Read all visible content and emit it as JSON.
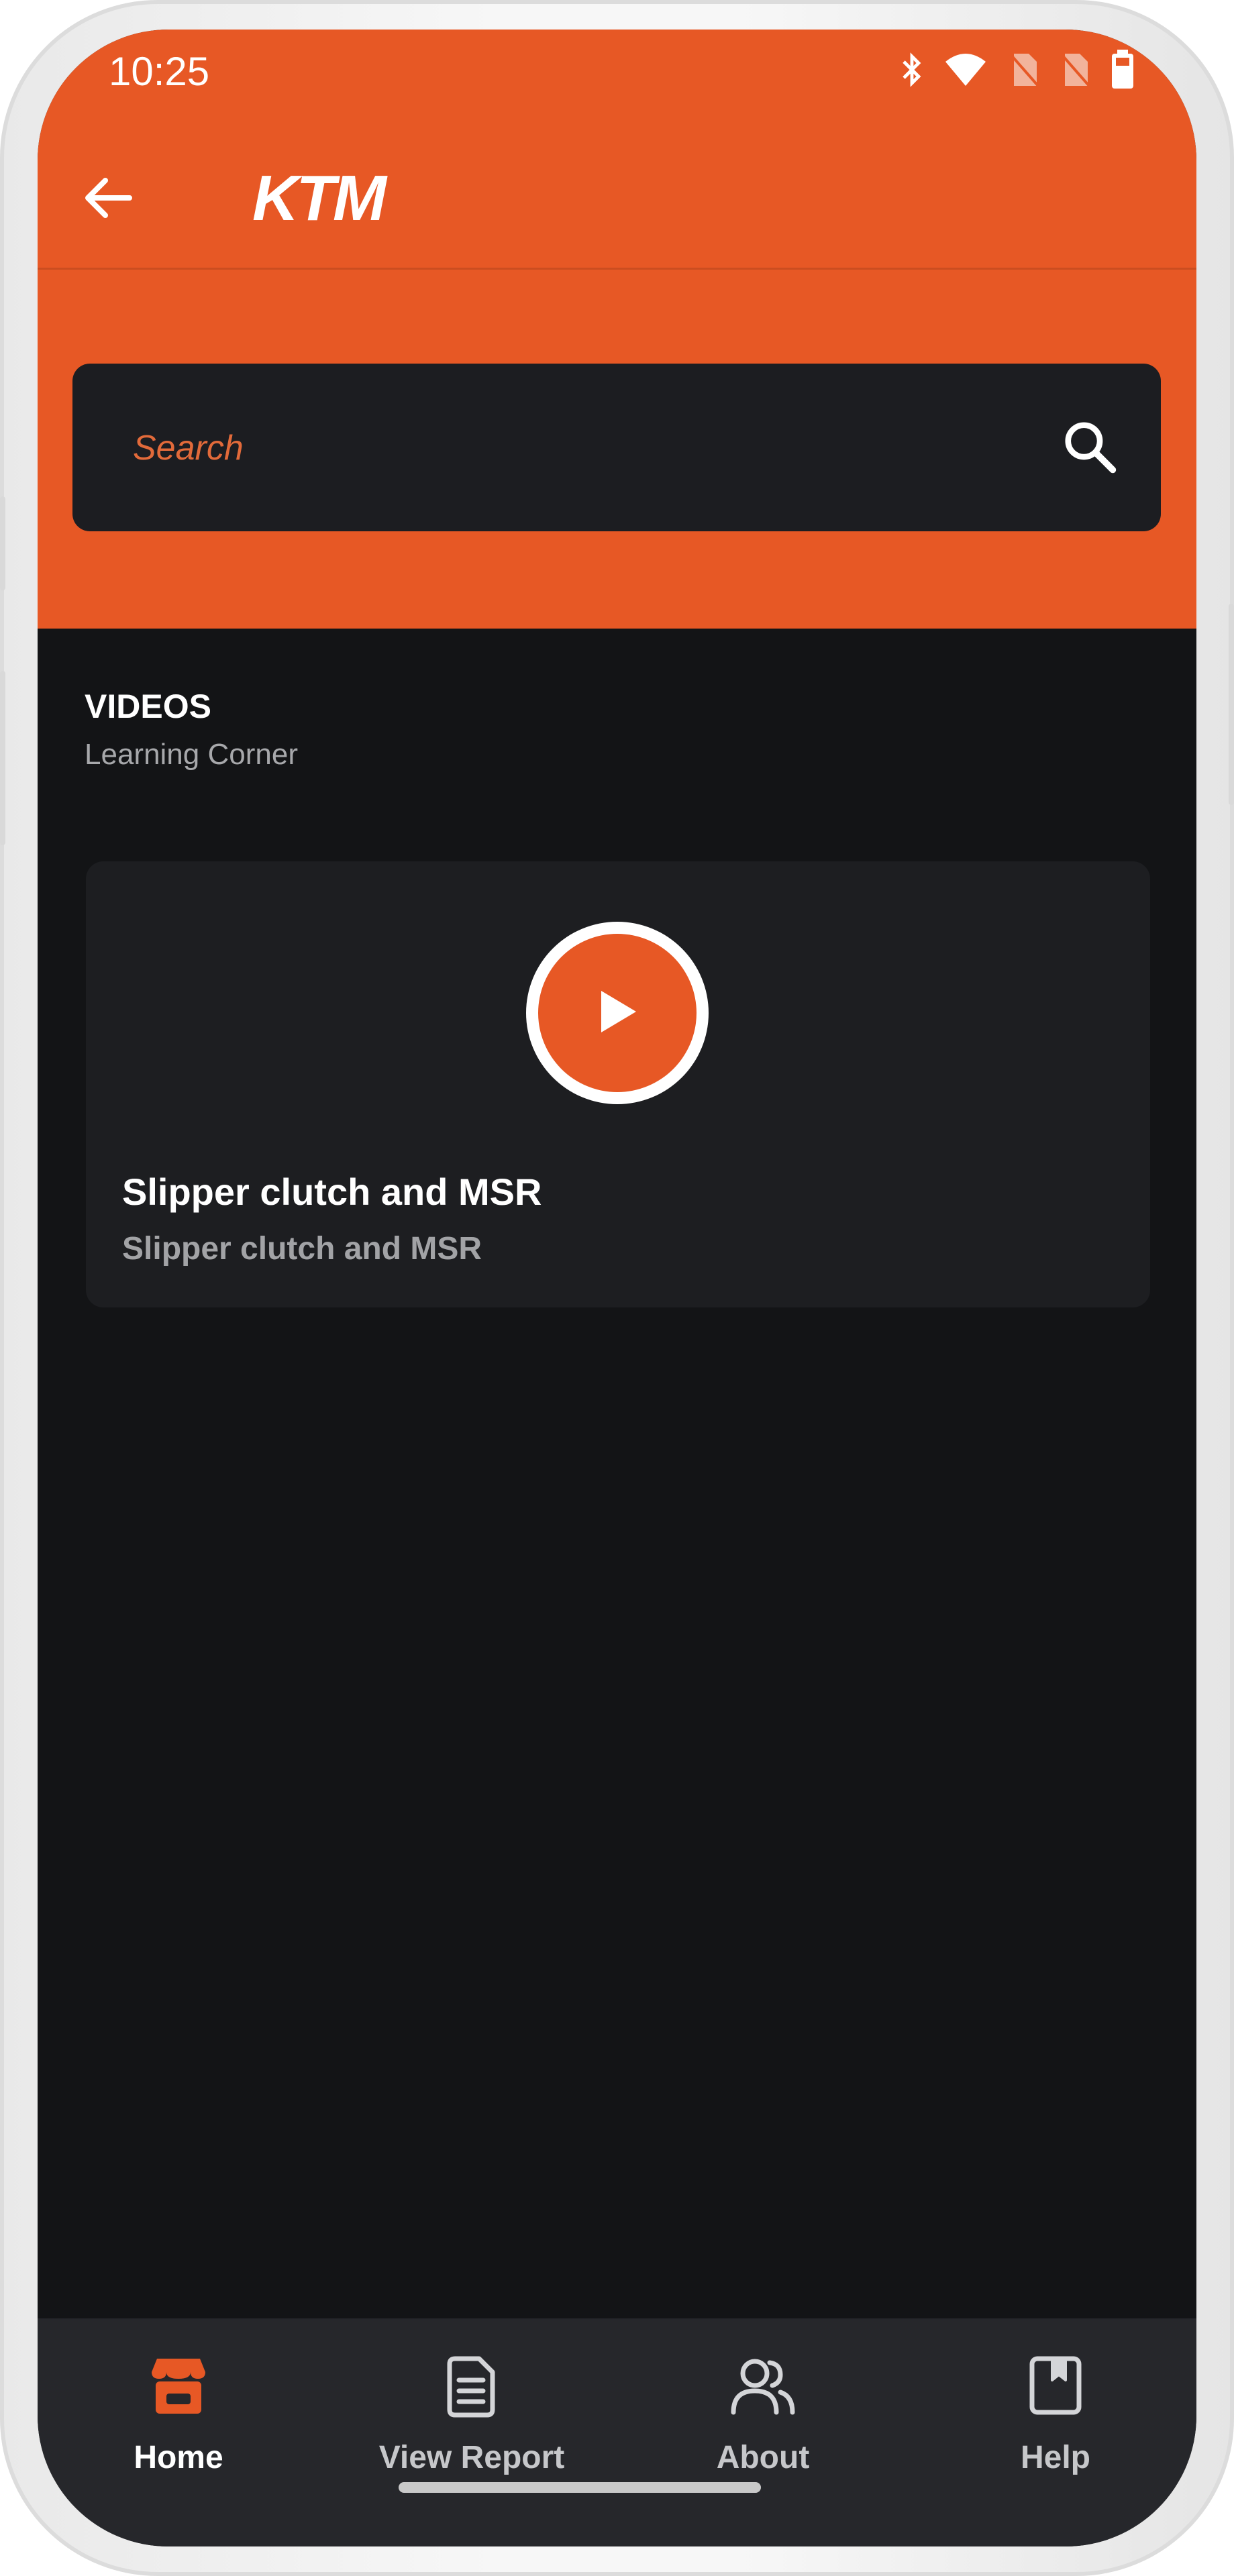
{
  "status_bar": {
    "time": "10:25",
    "icons": [
      "bluetooth-icon",
      "wifi-icon",
      "no-sim-icon",
      "no-sim-icon",
      "battery-icon"
    ]
  },
  "app_bar": {
    "back_icon": "arrow-left-icon",
    "logo_text": "KTM"
  },
  "search": {
    "placeholder": "Search",
    "value": "",
    "icon": "search-icon"
  },
  "section": {
    "title": "VIDEOS",
    "subtitle": "Learning Corner"
  },
  "videos": [
    {
      "title": "Slipper clutch and MSR",
      "subtitle": "Slipper clutch and MSR",
      "icon": "play-icon"
    }
  ],
  "bottom_nav": {
    "items": [
      {
        "label": "Home",
        "icon": "store-icon",
        "active": true
      },
      {
        "label": "View Report",
        "icon": "document-icon",
        "active": false
      },
      {
        "label": "About",
        "icon": "people-icon",
        "active": false
      },
      {
        "label": "Help",
        "icon": "bookmark-icon",
        "active": false
      }
    ]
  },
  "colors": {
    "accent": "#e75825",
    "background": "#131416",
    "card": "#1d1e21",
    "nav": "#26272b"
  }
}
